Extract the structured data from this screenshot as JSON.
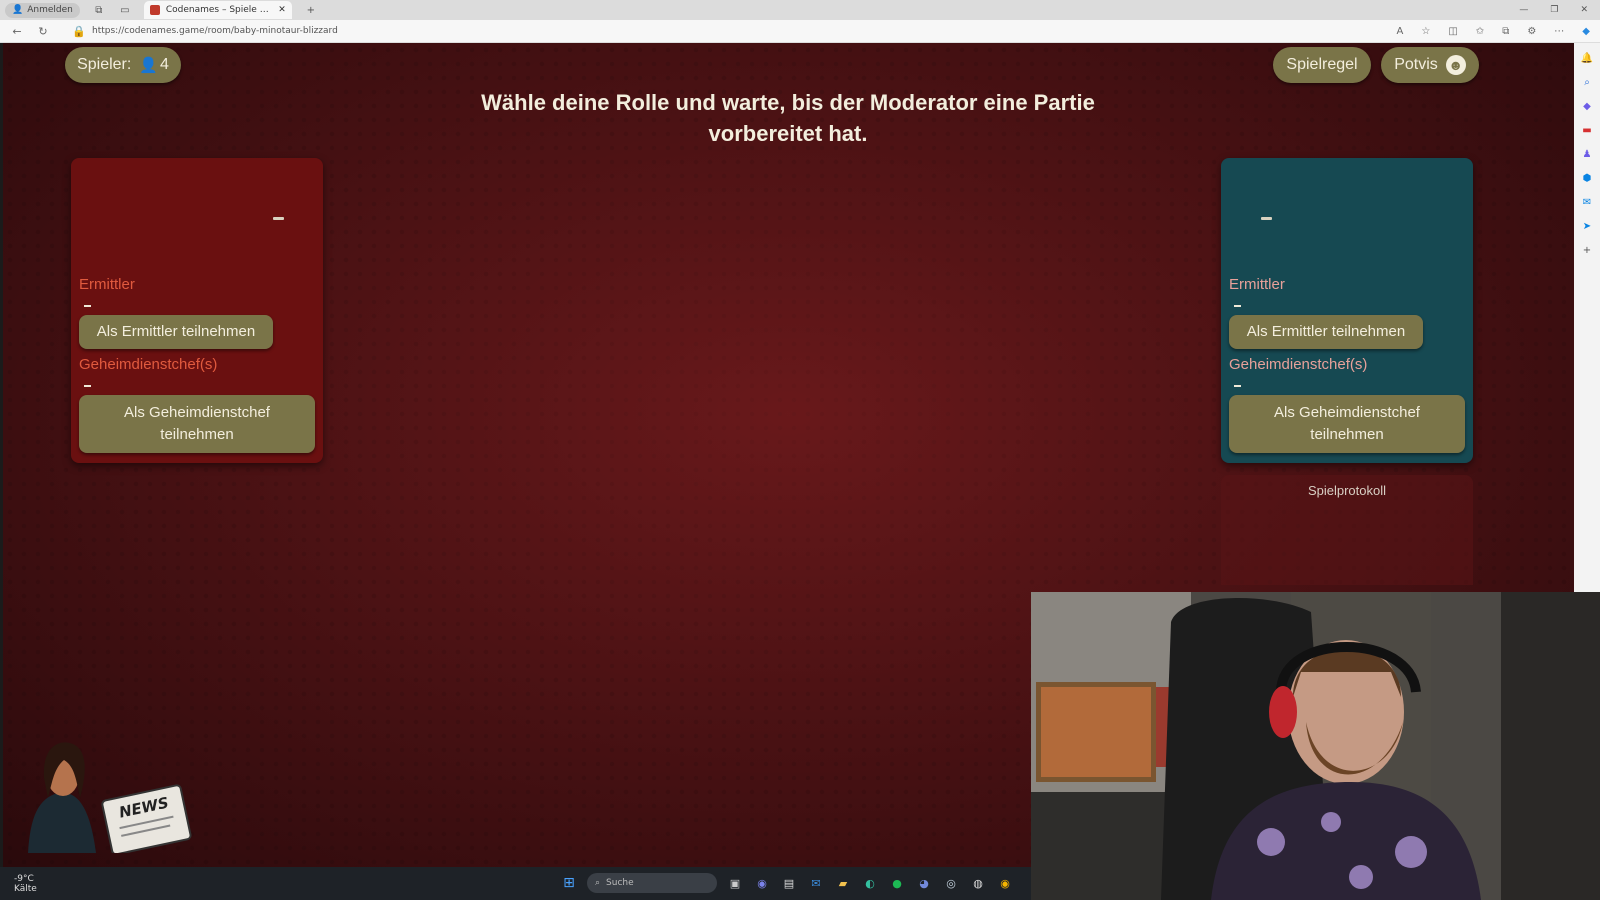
{
  "browser": {
    "profile_label": "Anmelden",
    "tab_title": "Codenames – Spiele online mit d",
    "url": "https://codenames.game/room/baby-minotaur-blizzard"
  },
  "game": {
    "players_label": "Spieler:",
    "players_count": "4",
    "rules_button": "Spielregel",
    "user_button": "Potvis",
    "headline": "Wähle deine Rolle und warte, bis der Moderator eine Partie vorbereitet hat.",
    "log_title": "Spielprotokoll",
    "red_team": {
      "operatives_label": "Ermittler",
      "join_operative": "Als Ermittler teilnehmen",
      "spymasters_label": "Geheimdienstchef(s)",
      "join_spymaster": "Als Geheimdienstchef teilnehmen"
    },
    "blue_team": {
      "operatives_label": "Ermittler",
      "join_operative": "Als Ermittler teilnehmen",
      "spymasters_label": "Geheimdienstchef(s)",
      "join_spymaster": "Als Geheimdienstchef teilnehmen"
    },
    "mascot_news": "NEWS"
  },
  "taskbar": {
    "temperature": "-9°C",
    "weather": "Kälte",
    "search_placeholder": "Suche"
  },
  "colors": {
    "red_team": "#6a1010",
    "blue_team": "#164952",
    "button": "#7a7448",
    "background": "#4a1214"
  }
}
